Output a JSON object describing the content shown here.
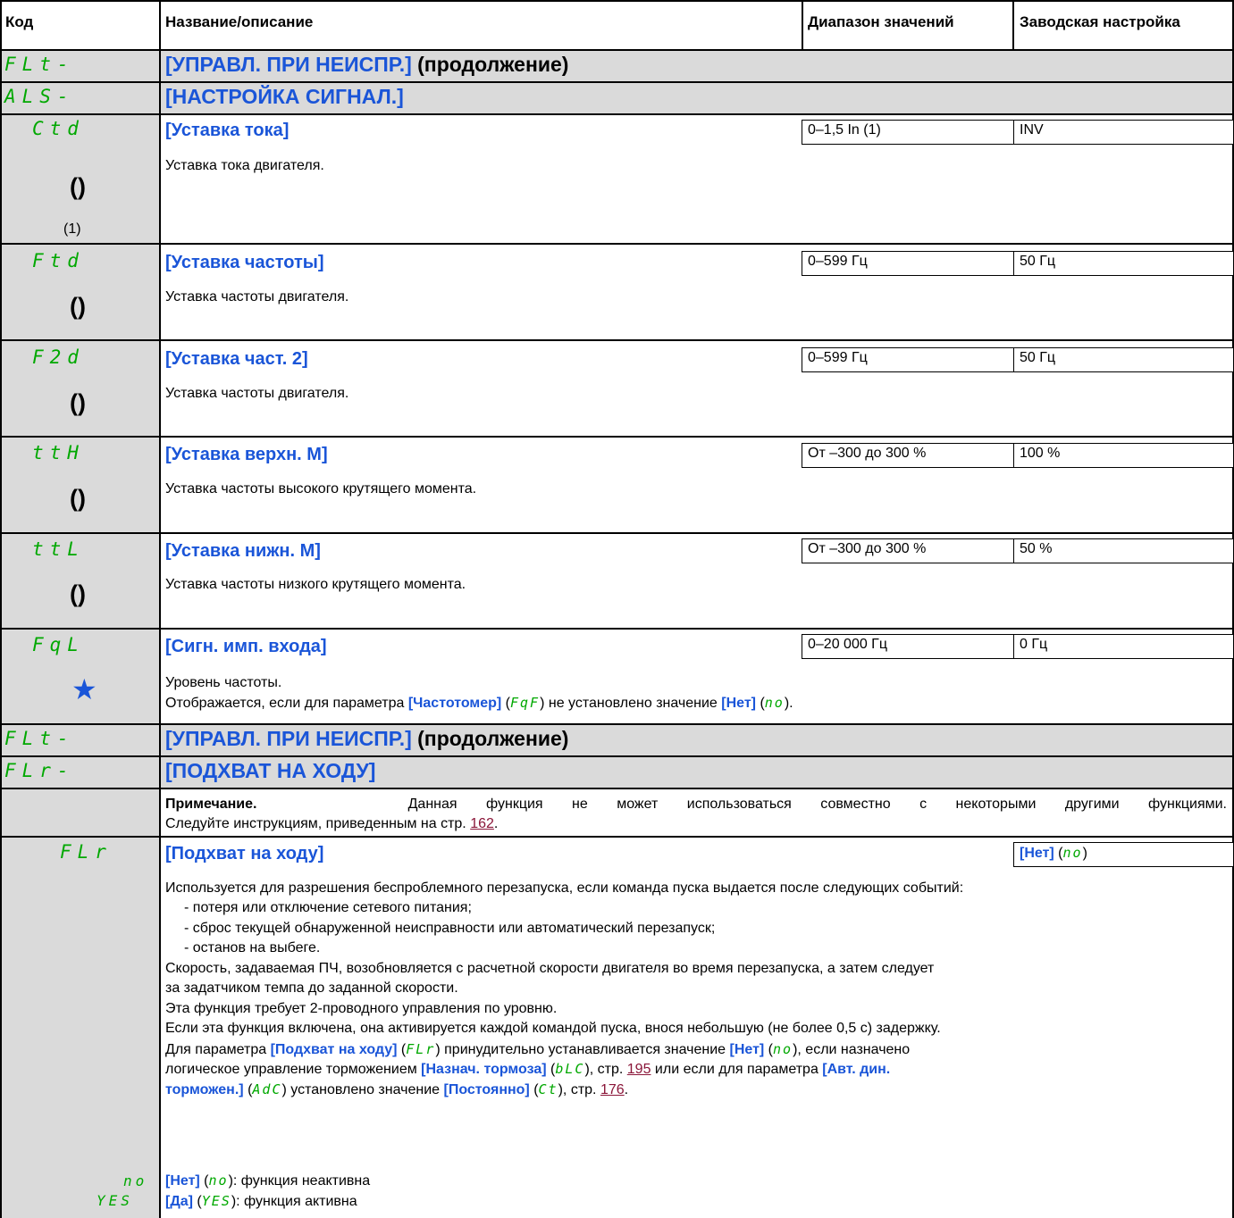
{
  "header": {
    "code": "Код",
    "name": "Название/описание",
    "range": "Диапазон значений",
    "factory": "Заводская настройка"
  },
  "sections": {
    "flt1": {
      "code": "FLt-",
      "title": "[УПРАВЛ. ПРИ НЕИСПР.]",
      "suffix": "(продолжение)"
    },
    "als": {
      "code": "ALS-",
      "title": "[НАСТРОЙКА СИГНАЛ.]"
    },
    "flt2": {
      "code": "FLt-",
      "title": "[УПРАВЛ. ПРИ НЕИСПР.]",
      "suffix": "(продолжение)"
    },
    "flr_sec": {
      "code": "FLr-",
      "title": "[ПОДХВАТ НА ХОДУ]"
    }
  },
  "params": [
    {
      "code": "Ctd",
      "name": "[Уставка тока]",
      "range": "0–1,5 In (1)",
      "factory": "INV",
      "desc": "Уставка тока двигателя.",
      "note": "(1)"
    },
    {
      "code": "Ftd",
      "name": "[Уставка частоты]",
      "range": "0–599 Гц",
      "factory": "50 Гц",
      "desc": "Уставка частоты двигателя."
    },
    {
      "code": "F2d",
      "name": "[Уставка част. 2]",
      "range": "0–599 Гц",
      "factory": "50 Гц",
      "desc": "Уставка частоты двигателя."
    },
    {
      "code": "ttH",
      "name": "[Уставка верхн. М]",
      "range": "От –300 до 300 %",
      "factory": "100 %",
      "desc": "Уставка частоты высокого крутящего момента."
    },
    {
      "code": "ttL",
      "name": "[Уставка нижн. М]",
      "range": "От –300 до 300 %",
      "factory": "50 %",
      "desc": "Уставка частоты низкого крутящего момента."
    },
    {
      "code": "FqL",
      "name": "[Сигн. имп. входа]",
      "range": "0–20 000 Гц",
      "factory": "0 Гц",
      "desc": "Уровень частоты."
    }
  ],
  "fql_shown": {
    "a": "Отображается, если для параметра ",
    "b": "[Частотомер]",
    "c": "(",
    "d": "FqF",
    "e": ") не установлено значение ",
    "f": "[Нет]",
    "g": "(",
    "h": "no",
    "i": ")."
  },
  "flr_note": {
    "label": "Примечание.",
    "text1": "Данная функция не может использоваться совместно с некоторыми другими функциями.",
    "text2": "Следуйте инструкциям, приведенным на стр. ",
    "page": "162",
    "end": "."
  },
  "flr": {
    "code": "FLr",
    "name": "[Подхват на ходу]",
    "factory_bold": "[Нет]",
    "factory_code": "no",
    "p1": "Используется для разрешения беспроблемного перезапуска, если команда пуска выдается после следующих событий:",
    "b1": "- потеря или отключение сетевого питания;",
    "b2": "- сброс текущей обнаруженной неисправности или автоматический перезапуск;",
    "b3": "- останов на выбеге.",
    "p2": "Скорость, задаваемая ПЧ, возобновляется с расчетной скорости двигателя во время перезапуска, а затем следует",
    "p3": "за задатчиком темпа до заданной скорости.",
    "p4": "Эта функция требует 2-проводного управления по уровню.",
    "p5": "Если эта функция включена, она активируется каждой командой пуска, внося небольшую (не более 0,5 с) задержку.",
    "l6a": "Для параметра ",
    "l6b": "[Подхват на ходу]",
    "l6c": "FLr",
    "l6d": " принудительно устанавливается значение ",
    "l6e": "[Нет]",
    "l6f": "no",
    "l6g": ", если назначено",
    "l7a": "логическое управление торможением ",
    "l7b": "[Назнач. тормоза]",
    "l7c": "bLC",
    "l7d": ", стр. ",
    "l7e": "195",
    "l7f": " или если для параметра ",
    "l7g": "[Авт. дин.",
    "l8a": "торможен.]",
    "l8b": "AdC",
    "l8c": " установлено значение ",
    "l8d": "[Постоянно]",
    "l8e": "Ct",
    "l8f": ", стр. ",
    "l8g": "176",
    "l8h": "."
  },
  "options": [
    {
      "code": "no",
      "label": "[Нет]",
      "rest": ": функция неактивна"
    },
    {
      "code": "YES",
      "label": "[Да]",
      "rest": ": функция активна"
    }
  ]
}
